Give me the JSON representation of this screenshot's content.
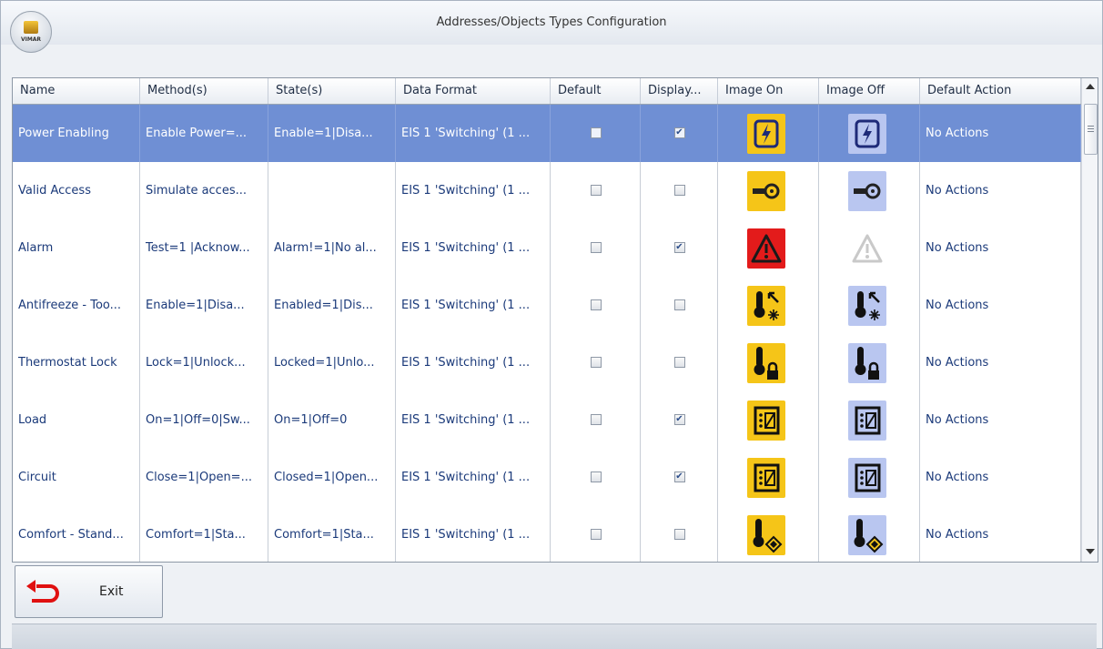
{
  "window": {
    "title": "Addresses/Objects Types Configuration",
    "logo_text": "VIMAR"
  },
  "columns": [
    "Name",
    "Method(s)",
    "State(s)",
    "Data Format",
    "Default",
    "Display...",
    "Image On",
    "Image Off",
    "Default Action"
  ],
  "rows": [
    {
      "name": "Power Enabling",
      "method": "Enable Power=...",
      "state": "Enable=1|Disa...",
      "format": "EIS 1 'Switching' (1 ...",
      "default": false,
      "display": true,
      "icon": "lightning-icon",
      "action": "No Actions"
    },
    {
      "name": "Valid Access",
      "method": "Simulate acces...",
      "state": "",
      "format": "EIS 1 'Switching' (1 ...",
      "default": false,
      "display": false,
      "icon": "key-icon",
      "action": "No Actions"
    },
    {
      "name": "Alarm",
      "method": "Test=1 |Acknow...",
      "state": "Alarm!=1|No al...",
      "format": "EIS 1 'Switching' (1 ...",
      "default": false,
      "display": true,
      "icon": "warning-icon",
      "action": "No Actions"
    },
    {
      "name": "Antifreeze - Too...",
      "method": "Enable=1|Disa...",
      "state": "Enabled=1|Dis...",
      "format": "EIS 1 'Switching' (1 ...",
      "default": false,
      "display": false,
      "icon": "thermometer-snowflake-icon",
      "action": "No Actions"
    },
    {
      "name": "Thermostat Lock",
      "method": "Lock=1|Unlock...",
      "state": "Locked=1|Unlo...",
      "format": "EIS 1 'Switching' (1 ...",
      "default": false,
      "display": false,
      "icon": "thermometer-lock-icon",
      "action": "No Actions"
    },
    {
      "name": "Load",
      "method": "On=1|Off=0|Sw...",
      "state": "On=1|Off=0",
      "format": "EIS 1 'Switching' (1 ...",
      "default": false,
      "display": true,
      "icon": "load-icon",
      "action": "No Actions"
    },
    {
      "name": "Circuit",
      "method": "Close=1|Open=...",
      "state": "Closed=1|Open...",
      "format": "EIS 1 'Switching' (1 ...",
      "default": false,
      "display": true,
      "icon": "circuit-icon",
      "action": "No Actions"
    },
    {
      "name": "Comfort - Stand...",
      "method": "Comfort=1|Sta...",
      "state": "Comfort=1|Sta...",
      "format": "EIS 1 'Switching' (1 ...",
      "default": false,
      "display": false,
      "icon": "thermometer-comfort-icon",
      "action": "No Actions"
    }
  ],
  "selected_row": 0,
  "exit_label": "Exit",
  "colors": {
    "selected_row": "#6f8fd4",
    "image_on_bg": "#f5c518",
    "image_off_bg": "#b9c6f0",
    "alarm_bg": "#e31b1b"
  }
}
